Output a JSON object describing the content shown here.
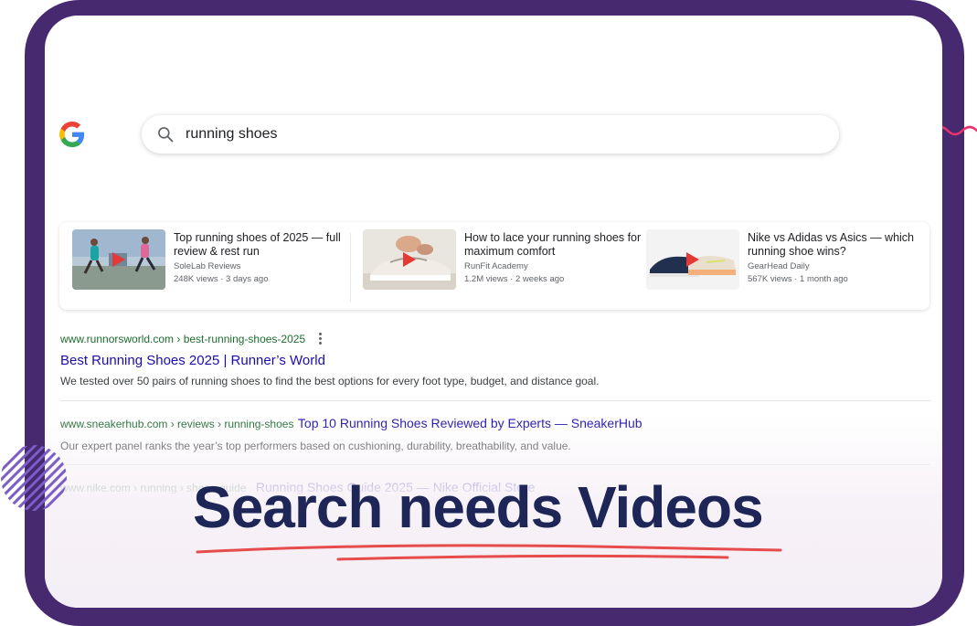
{
  "search": {
    "query": "running shoes"
  },
  "videos": [
    {
      "title": "Top running shoes of 2025 — full review & rest run",
      "channel": "SoleLab Reviews",
      "meta": "248K views · 3 days ago"
    },
    {
      "title": "How to lace your running shoes for maximum comfort",
      "channel": "RunFit Academy",
      "meta": "1.2M views · 2 weeks ago"
    },
    {
      "title": "Nike vs Adidas vs Asics — which running shoe wins?",
      "channel": "GearHead Daily",
      "meta": "567K views · 1 month ago"
    }
  ],
  "results": [
    {
      "url": "www.runnorsworld.com › best-running-shoes-2025",
      "title": "Best Running Shoes 2025  | Runner’s World",
      "snippet": "We tested over 50 pairs of running shoes to find the best options for every foot type, budget, and distance goal."
    },
    {
      "url": "www.sneakerhub.com › reviews › running-shoes",
      "title": "Top 10 Running Shoes Reviewed by Experts — SneakerHub",
      "snippet": "Our expert panel ranks the year’s top performers based on cushioning, durability, breathability, and value."
    },
    {
      "url": "www.nike.com › running › shoes-guide",
      "title": "Running Shoes Guide 2025 — Nike Official Store"
    }
  ],
  "headline": "Search needs Videos",
  "colors": {
    "frame": "#46296f",
    "accent_pink": "#e8336d",
    "link_blue": "#1a0dab",
    "url_green": "#1e6b2e",
    "headline_navy": "#1e2557",
    "underline_red": "#e74c4c"
  },
  "icons": [
    "google-logo-icon",
    "search-icon",
    "play-icon",
    "more-options-icon"
  ]
}
